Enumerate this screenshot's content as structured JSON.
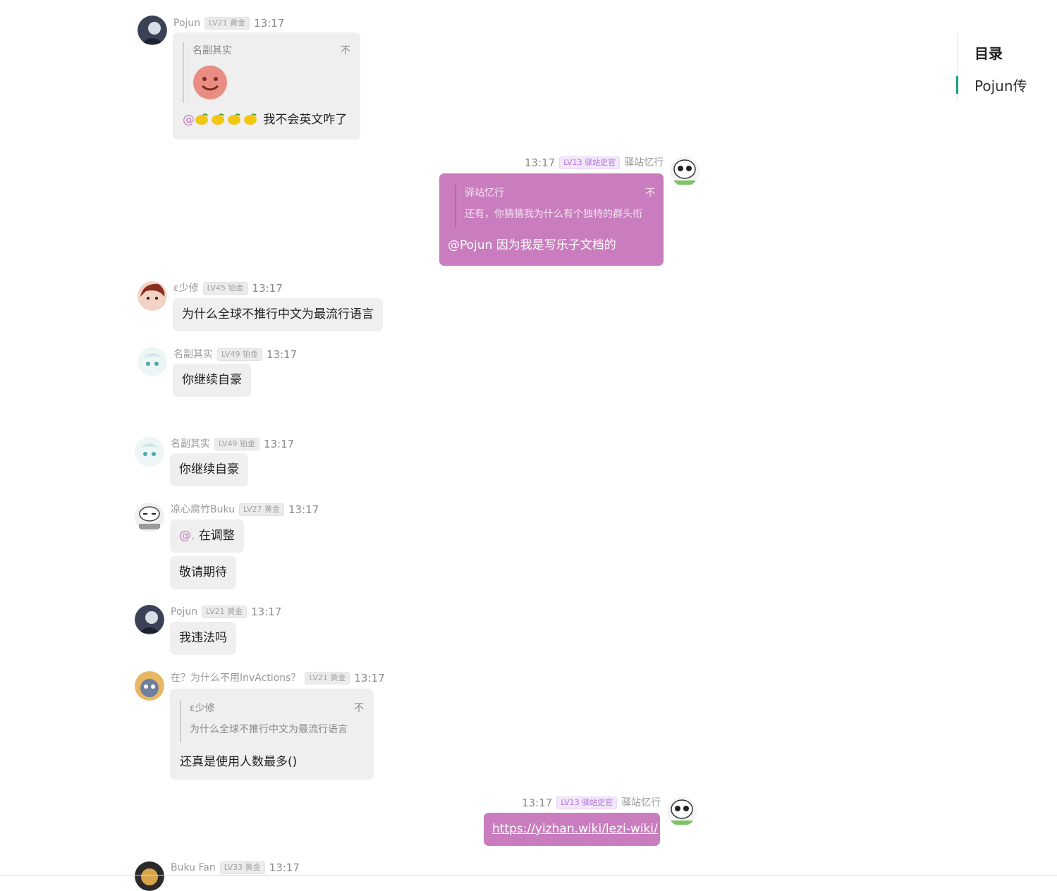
{
  "toc": {
    "title": "目录",
    "items": [
      {
        "label": "Pojun传"
      }
    ]
  },
  "messages": [
    {
      "id": "m1",
      "name": "Pojun",
      "level": "LV21",
      "rank": "黄金",
      "time": "13:17",
      "quote": {
        "author": "名副其实",
        "close": "不"
      },
      "mention": "@",
      "text": "我不会英文咋了",
      "emoji": "lemon"
    },
    {
      "id": "m2",
      "name": "驿站忆行",
      "level": "LV13",
      "rank": "驿站史官",
      "time": "13:17",
      "quote": {
        "author": "驿站忆行",
        "text": "还有，你猜猜我为什么有个独特的群头衔",
        "close": "不"
      },
      "text": "@Pojun 因为我是写乐子文档的"
    },
    {
      "id": "m3",
      "name": "ε少修",
      "level": "LV45",
      "rank": "铂金",
      "time": "13:17",
      "text": "为什么全球不推行中文为最流行语言"
    },
    {
      "id": "m4",
      "name": "名副其实",
      "level": "LV49",
      "rank": "铂金",
      "time": "13:17",
      "text": "你继续自豪"
    },
    {
      "id": "m5",
      "name": "名副其实",
      "level": "LV49",
      "rank": "铂金",
      "time": "13:17",
      "text": "你继续自豪"
    },
    {
      "id": "m6",
      "name": "凉心腐竹Buku",
      "level": "LV27",
      "rank": "黄金",
      "time": "13:17",
      "mention": "@.",
      "text": "在调整",
      "text2": "敬请期待"
    },
    {
      "id": "m7",
      "name": "Pojun",
      "level": "LV21",
      "rank": "黄金",
      "time": "13:17",
      "text": "我违法吗"
    },
    {
      "id": "m8",
      "name": "在？为什么不用InvActions？",
      "level": "LV21",
      "rank": "黄金",
      "time": "13:17",
      "quote": {
        "author": "ε少修",
        "text": "为什么全球不推行中文为最流行语言",
        "close": "不"
      },
      "text": "还真是使用人数最多()"
    },
    {
      "id": "m9",
      "name": "驿站忆行",
      "level": "LV13",
      "rank": "驿站史官",
      "time": "13:17",
      "link": "https://yizhan.wiki/lezi-wiki/"
    },
    {
      "id": "m10",
      "name": "Buku Fan",
      "level": "LV33",
      "rank": "黄金",
      "time": "13:17"
    }
  ],
  "colors": {
    "accent_pink": "#c97dbe",
    "bubble_gray": "#efefef",
    "toc_accent": "#1a9e8e"
  }
}
